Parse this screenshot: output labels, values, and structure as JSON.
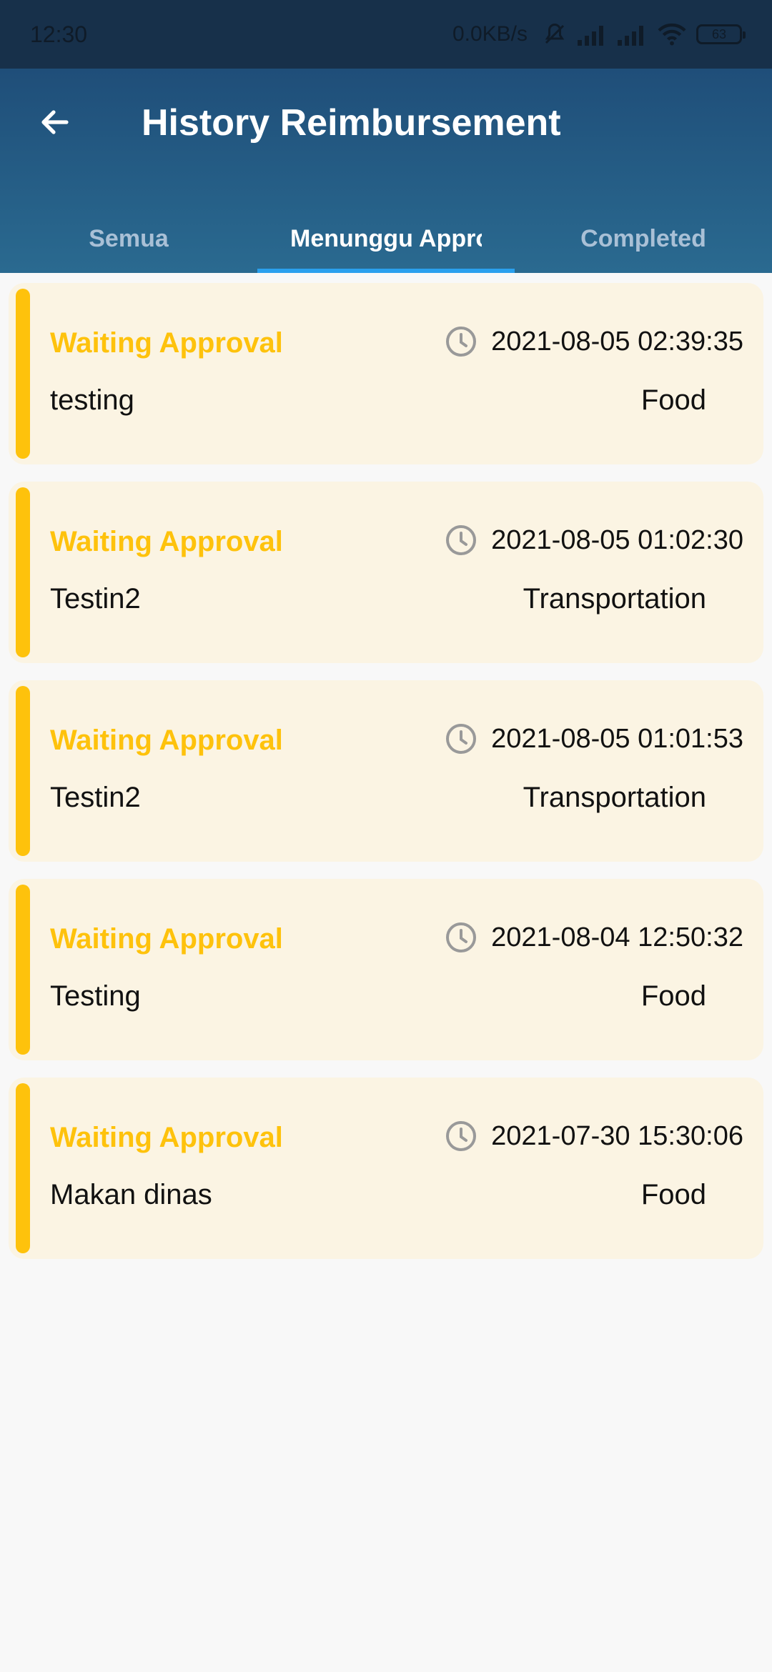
{
  "status_bar": {
    "time": "12:30",
    "net_speed": "0.0KB/s",
    "battery": "63",
    "icons": [
      "mute-bell-icon",
      "signal-icon",
      "signal-icon",
      "wifi-icon",
      "battery-icon"
    ]
  },
  "header": {
    "title": "History Reimbursement",
    "back_icon": "arrow-left-icon"
  },
  "tabs": [
    {
      "label": "Semua",
      "active": false
    },
    {
      "label": "Menunggu Approval",
      "active": true
    },
    {
      "label": "Completed",
      "active": false
    }
  ],
  "colors": {
    "appbar": "#1f4e79",
    "accent_indicator": "#2aa0ee",
    "status_yellow": "#fec20c",
    "card_bg": "#fbf4e3"
  },
  "items": [
    {
      "status": "Waiting Approval",
      "name": "testing",
      "datetime": "2021-08-05 02:39:35",
      "category": "Food"
    },
    {
      "status": "Waiting Approval",
      "name": "Testin2",
      "datetime": "2021-08-05 01:02:30",
      "category": "Transportation"
    },
    {
      "status": "Waiting Approval",
      "name": "Testin2",
      "datetime": "2021-08-05 01:01:53",
      "category": "Transportation"
    },
    {
      "status": "Waiting Approval",
      "name": "Testing",
      "datetime": "2021-08-04 12:50:32",
      "category": "Food"
    },
    {
      "status": "Waiting Approval",
      "name": "Makan dinas",
      "datetime": "2021-07-30 15:30:06",
      "category": "Food"
    }
  ]
}
